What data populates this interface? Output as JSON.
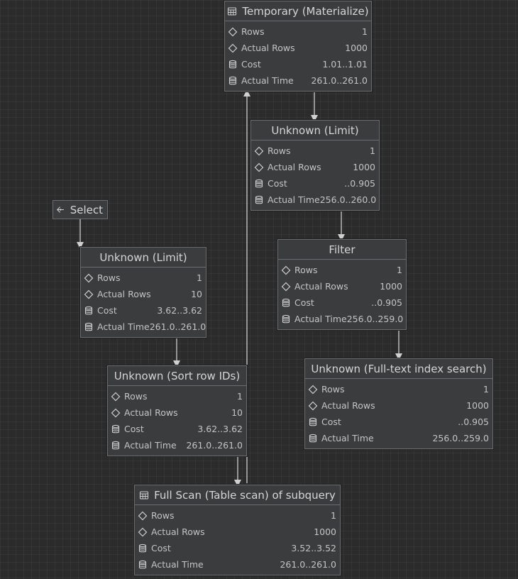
{
  "colors": {
    "background": "#2b2b2b",
    "node": "#3b3c3e",
    "border": "#6a6c70",
    "wire": "#d0d0d0"
  },
  "select_button": {
    "label": "Select",
    "icon": "arrow-left-icon"
  },
  "row_labels": {
    "rows": "Rows",
    "actual_rows": "Actual Rows",
    "cost": "Cost",
    "actual_time": "Actual Time"
  },
  "nodes": {
    "materialize": {
      "title": "Temporary (Materialize)",
      "icon": "table-icon",
      "rows": "1",
      "actual_rows": "1000",
      "cost": "1.01..1.01",
      "actual_time": "261.0..261.0"
    },
    "limit_top": {
      "title": "Unknown (Limit)",
      "icon": "",
      "rows": "1",
      "actual_rows": "1000",
      "cost": "..0.905",
      "actual_time": "256.0..260.0"
    },
    "filter": {
      "title": "Filter",
      "icon": "",
      "rows": "1",
      "actual_rows": "1000",
      "cost": "..0.905",
      "actual_time": "256.0..259.0"
    },
    "fulltext": {
      "title": "Unknown (Full-text index search)",
      "icon": "",
      "rows": "1",
      "actual_rows": "1000",
      "cost": "..0.905",
      "actual_time": "256.0..259.0"
    },
    "limit_left": {
      "title": "Unknown (Limit)",
      "icon": "",
      "rows": "1",
      "actual_rows": "10",
      "cost": "3.62..3.62",
      "actual_time": "261.0..261.0"
    },
    "sort": {
      "title": "Unknown (Sort row IDs)",
      "icon": "",
      "rows": "1",
      "actual_rows": "10",
      "cost": "3.62..3.62",
      "actual_time": "261.0..261.0"
    },
    "fullscan": {
      "title": "Full Scan (Table scan) of subquery",
      "icon": "table-icon",
      "rows": "1",
      "actual_rows": "1000",
      "cost": "3.52..3.52",
      "actual_time": "261.0..261.0"
    }
  }
}
